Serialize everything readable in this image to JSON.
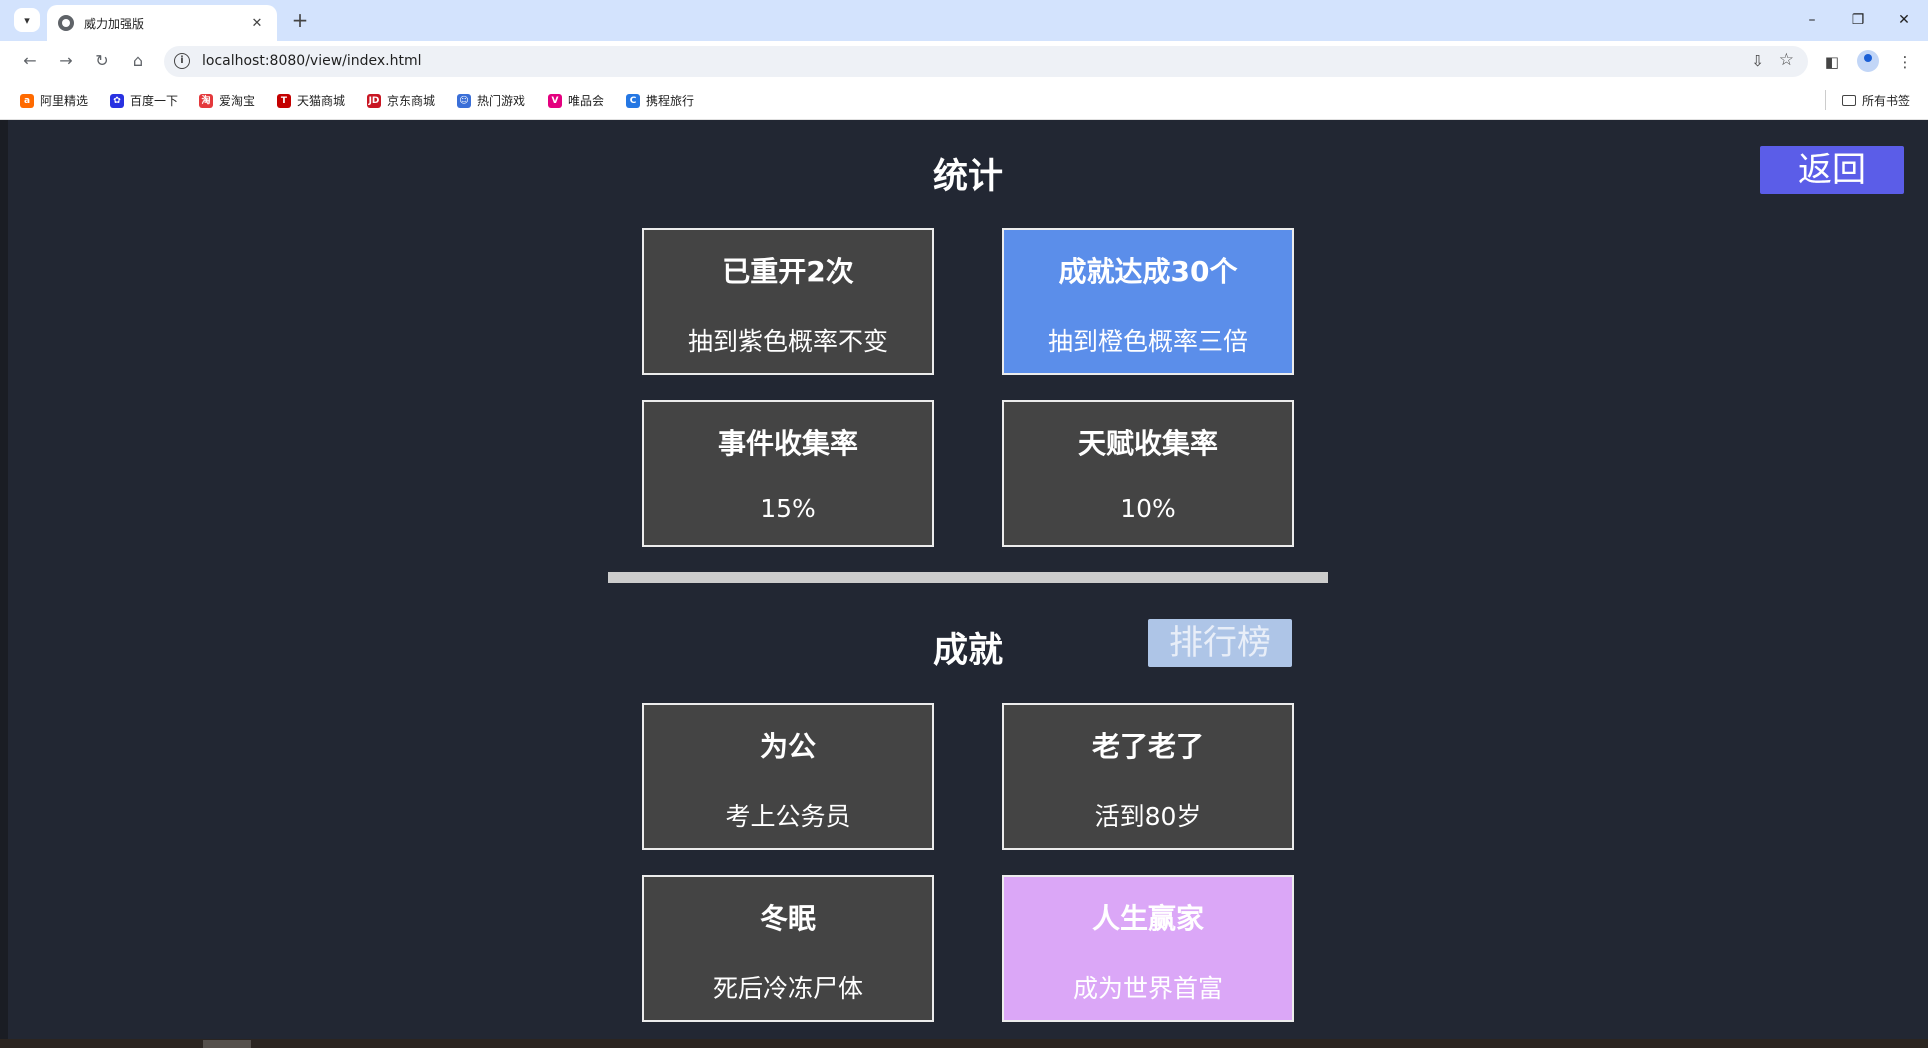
{
  "browser": {
    "tab_title": "威力加强版",
    "url": "localhost:8080/view/index.html",
    "tab_close": "✕",
    "new_tab": "+",
    "minimize": "–",
    "restore": "❐",
    "close": "✕",
    "back": "←",
    "forward": "→",
    "reload": "↻",
    "home": "⌂",
    "install": "⇩",
    "star": "☆",
    "sidepanel": "◧",
    "menu": "⋮"
  },
  "bookmarks": {
    "items": [
      {
        "label": "阿里精选",
        "icon": "alibaba-icon",
        "color": "#ff6a00"
      },
      {
        "label": "百度一下",
        "icon": "baidu-paw-icon",
        "color": "#2932e1"
      },
      {
        "label": "爱淘宝",
        "icon": "taobao-icon",
        "color": "#e4393c"
      },
      {
        "label": "天猫商城",
        "icon": "tmall-icon",
        "color": "#c40000"
      },
      {
        "label": "京东商城",
        "icon": "jd-icon",
        "color": "#c91623"
      },
      {
        "label": "热门游戏",
        "icon": "game-icon",
        "color": "#3a6fd8"
      },
      {
        "label": "唯品会",
        "icon": "vip-icon",
        "color": "#e4007f"
      },
      {
        "label": "携程旅行",
        "icon": "ctrip-icon",
        "color": "#2577e3"
      }
    ],
    "all_bookmarks": "所有书签"
  },
  "page": {
    "stats_title": "统计",
    "back_button": "返回",
    "stats": [
      {
        "title": "已重开2次",
        "desc": "抽到紫色概率不变",
        "color": "#444444"
      },
      {
        "title": "成就达成30个",
        "desc": "抽到橙色概率三倍",
        "color": "#5b8eea"
      },
      {
        "title": "事件收集率",
        "desc": "15%",
        "color": "#444444"
      },
      {
        "title": "天赋收集率",
        "desc": "10%",
        "color": "#444444"
      }
    ],
    "achievements_title": "成就",
    "ranking_button": "排行榜",
    "achievements": [
      {
        "title": "为公",
        "desc": "考上公务员",
        "color": "#444444"
      },
      {
        "title": "老了老了",
        "desc": "活到80岁",
        "color": "#444444"
      },
      {
        "title": "冬眠",
        "desc": "死后冷冻尸体",
        "color": "#444444"
      },
      {
        "title": "人生赢家",
        "desc": "成为世界首富",
        "color": "#dba7f7"
      }
    ]
  }
}
